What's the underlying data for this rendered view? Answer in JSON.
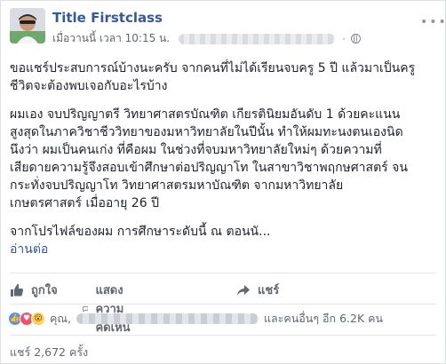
{
  "post": {
    "author": "Title Firstclass",
    "timestamp": "เมื่อวานนี้ เวลา 10:15 น.",
    "more_icon": "more-options-icon",
    "body": {
      "paragraph1": [
        "ขอแชร์ประสบการณ์บ้างนะครับ จากคนที่ไม่ได้เรียนจบครู 5 ปี แล้วมาเป็นครู",
        "ชีวิตจะต้องพบเจอกับอะไรบ้าง"
      ],
      "paragraph2": [
        "ผมเอง จบปริญญาตรี วิทยาศาสตรบัณฑิต เกียรตินิยมอันดับ 1 ด้วยคะแนน",
        "สูงสุดในภาควิชาชีววิทยาของมหาวิทยาลัยในปีนั้น ทำให้ผมทะนงตนเองนิด",
        "นึงว่า ผมเป็นคนเก่ง ที่คือผม ในช่วงที่จบมหาวิทยาลัยใหม่ๆ ด้วยความที่",
        "เสียดายความรู้จึงสอบเข้าศึกษาต่อปริญญาโท ในสาขาวิชาพฤกษศาสตร์ จน",
        "กระทั่งจบปริญญาโท วิทยาศาสตรมหาบัณฑิต จากมหาวิทยาลัย",
        "เกษตรศาสตร์ เมื่ออายุ 26 ปี"
      ],
      "paragraph3": "จากโปรไฟล์ของผม การศึกษาระดับนี้ ณ ตอนนั...",
      "read_more": "อ่านต่อ"
    },
    "actions": {
      "like": "ถูกใจ",
      "comment": "แสดงความคิดเห็น",
      "share": "แชร์"
    },
    "reactions": {
      "prefix": "คุณ,",
      "suffix": "และคนอื่นๆ อีก 6.2K คน",
      "icons": [
        "like-reaction-icon",
        "love-reaction-icon",
        "wow-reaction-icon"
      ]
    },
    "shares_text": "แชร์ 2,672 ครั้ง"
  },
  "colors": {
    "link": "#365899",
    "meta": "#616770",
    "like": "#5890ff",
    "love": "#f25268",
    "wow": "#fdd05b"
  }
}
